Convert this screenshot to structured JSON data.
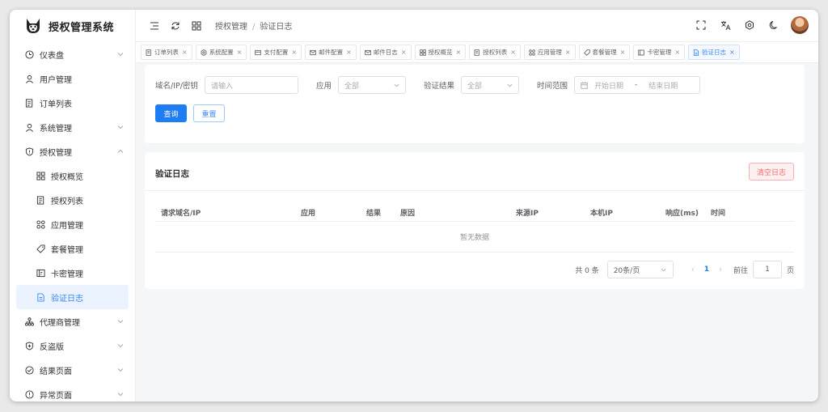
{
  "app": {
    "title": "授权管理系统"
  },
  "sidebar": {
    "items": [
      {
        "label": "仪表盘"
      },
      {
        "label": "用户管理"
      },
      {
        "label": "订单列表"
      },
      {
        "label": "系统管理"
      },
      {
        "label": "授权管理"
      },
      {
        "label": "授权概览"
      },
      {
        "label": "授权列表"
      },
      {
        "label": "应用管理"
      },
      {
        "label": "套餐管理"
      },
      {
        "label": "卡密管理"
      },
      {
        "label": "验证日志"
      },
      {
        "label": "代理商管理"
      },
      {
        "label": "反盗版"
      },
      {
        "label": "结果页面"
      },
      {
        "label": "异常页面"
      }
    ]
  },
  "header": {
    "breadcrumb": [
      "授权管理",
      "验证日志"
    ],
    "separator": "/"
  },
  "tabs": [
    {
      "label": "订单列表",
      "close": "×"
    },
    {
      "label": "系统配置",
      "close": "×"
    },
    {
      "label": "支付配置",
      "close": "×"
    },
    {
      "label": "邮件配置",
      "close": "×"
    },
    {
      "label": "邮件日志",
      "close": "×"
    },
    {
      "label": "授权概览",
      "close": "×"
    },
    {
      "label": "授权列表",
      "close": "×"
    },
    {
      "label": "应用管理",
      "close": "×"
    },
    {
      "label": "套餐管理",
      "close": "×"
    },
    {
      "label": "卡密管理",
      "close": "×"
    },
    {
      "label": "验证日志",
      "close": "×"
    }
  ],
  "filter": {
    "domain_label": "域名/IP/密钥",
    "domain_placeholder": "请输入",
    "app_label": "应用",
    "app_value": "全部",
    "result_label": "验证结果",
    "result_value": "全部",
    "time_label": "时间范围",
    "start_placeholder": "开始日期",
    "range_sep": "-",
    "end_placeholder": "结束日期",
    "query_button": "查询",
    "reset_button": "重置"
  },
  "logs": {
    "title": "验证日志",
    "clear_button": "清空日志",
    "columns": [
      "请求域名/IP",
      "应用",
      "结果",
      "原因",
      "来源IP",
      "本机IP",
      "响应(ms)",
      "时间"
    ],
    "empty_text": "暂无数据"
  },
  "pagination": {
    "total_text": "共 0 条",
    "page_size": "20条/页",
    "prev": "‹",
    "current_page": "1",
    "next": "›",
    "goto_label": "前往",
    "goto_value": "1",
    "page_suffix": "页"
  },
  "colors": {
    "primary": "#1e7cf5",
    "danger": "#f56c6c",
    "active_bg": "#eaf3ff"
  }
}
